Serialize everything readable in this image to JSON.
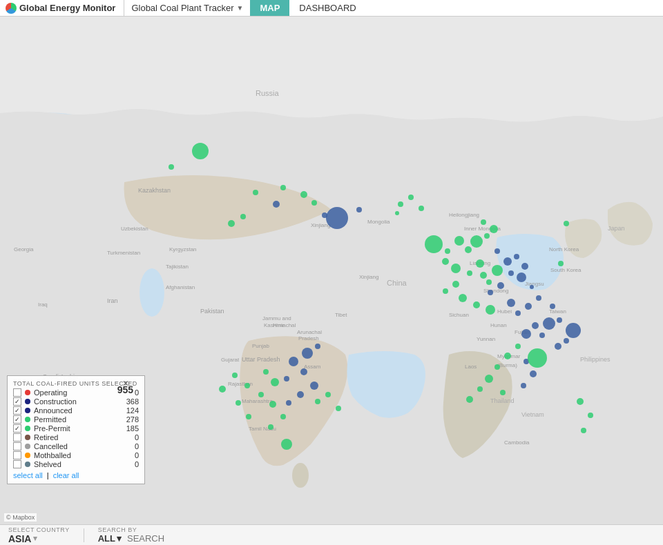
{
  "header": {
    "gem_label": "Global Energy Monitor",
    "tracker_label": "Global Coal Plant Tracker",
    "nav_map": "MAP",
    "nav_dashboard": "DASHBOARD"
  },
  "legend": {
    "title": "TOTAL COAL-FIRED UNITS SELECTED",
    "total": "955",
    "items": [
      {
        "label": "Operating",
        "value": "0",
        "color": "#e53935",
        "checked": false
      },
      {
        "label": "Construction",
        "value": "368",
        "color": "#1a237e",
        "checked": true
      },
      {
        "label": "Announced",
        "value": "124",
        "color": "#1a237e",
        "checked": true
      },
      {
        "label": "Permitted",
        "value": "278",
        "color": "#2ecc71",
        "checked": true
      },
      {
        "label": "Pre-Permit",
        "value": "185",
        "color": "#2ecc71",
        "checked": true
      },
      {
        "label": "Retired",
        "value": "0",
        "color": "#795548",
        "checked": false
      },
      {
        "label": "Cancelled",
        "value": "0",
        "color": "#9e9e9e",
        "checked": false
      },
      {
        "label": "Mothballed",
        "value": "0",
        "color": "#ff9800",
        "checked": false
      },
      {
        "label": "Shelved",
        "value": "0",
        "color": "#607d8b",
        "checked": false
      }
    ],
    "link_select_all": "select all",
    "link_clear_all": "clear all"
  },
  "bottom_bar": {
    "select_country_label": "SELECT COUNTRY",
    "country_value": "ASIA",
    "search_by_label": "SEARCH BY",
    "search_by_value": "ALL",
    "search_placeholder": "SEARCH"
  },
  "mapbox_label": "© Mapbox"
}
